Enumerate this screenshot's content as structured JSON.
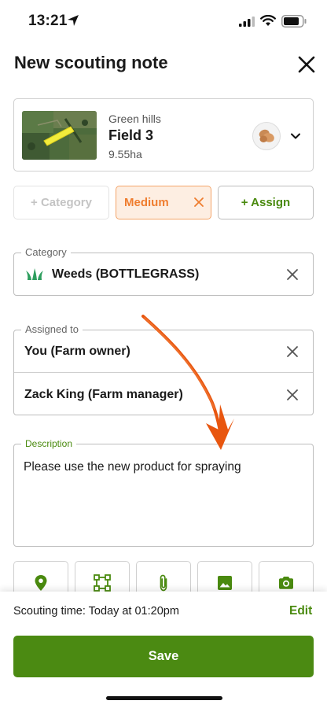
{
  "status_bar": {
    "time": "13:21"
  },
  "header": {
    "title": "New scouting note"
  },
  "field_card": {
    "farm": "Green hills",
    "field": "Field 3",
    "area": "9.55ha"
  },
  "chips": {
    "category": "+ Category",
    "priority": "Medium",
    "assign": "+ Assign"
  },
  "category": {
    "legend": "Category",
    "value": "Weeds (BOTTLEGRASS)"
  },
  "assigned": {
    "legend": "Assigned to",
    "people": [
      "You (Farm owner)",
      "Zack King (Farm manager)"
    ]
  },
  "description": {
    "legend": "Description",
    "text": "Please use the new product for spraying"
  },
  "attachments": [
    "location-pin-icon",
    "area-select-icon",
    "paperclip-icon",
    "image-icon",
    "camera-icon"
  ],
  "footer": {
    "scouting_time": "Scouting time: Today at 01:20pm",
    "edit_label": "Edit",
    "save_label": "Save"
  },
  "colors": {
    "accent_green": "#4a8a0f",
    "priority_orange": "#ef7d2f",
    "priority_bg": "#fdeee2",
    "annotation_arrow": "#e8560f"
  }
}
